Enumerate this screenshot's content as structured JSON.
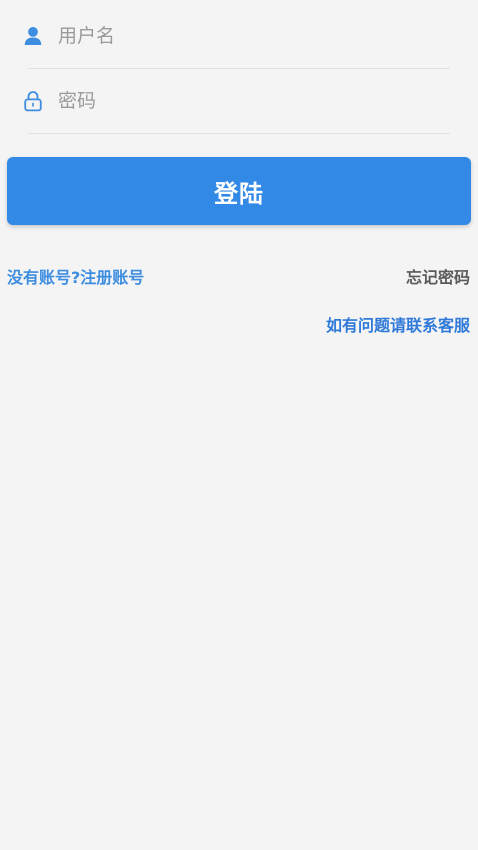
{
  "login_form": {
    "username": {
      "placeholder": "用户名",
      "value": "",
      "icon": "user-icon"
    },
    "password": {
      "placeholder": "密码",
      "value": "",
      "icon": "lock-icon"
    },
    "submit_label": "登陆"
  },
  "links": {
    "register": "没有账号?注册账号",
    "forgot_password": "忘记密码",
    "contact_support": "如有问题请联系客服"
  },
  "colors": {
    "accent": "#3289e6",
    "icon": "#3d8de0",
    "background": "#f4f4f5"
  }
}
